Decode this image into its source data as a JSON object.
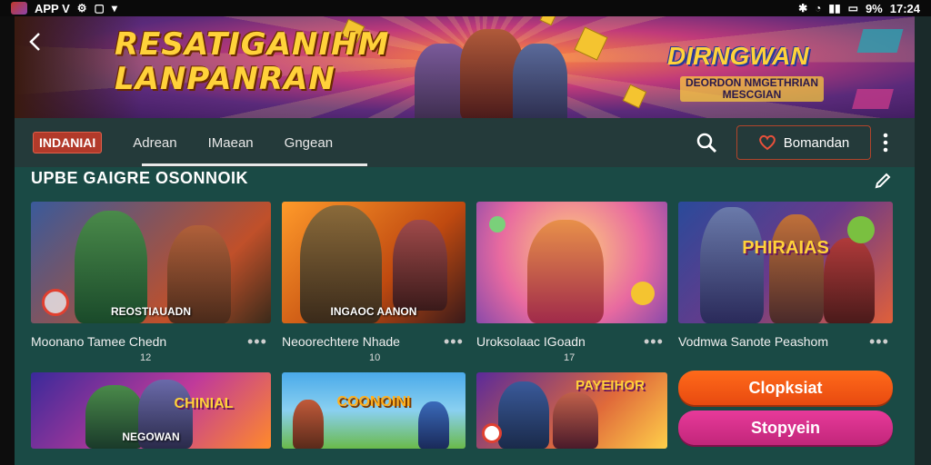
{
  "status_bar": {
    "app_label": "APP V",
    "battery": "9%",
    "time": "17:24"
  },
  "banner": {
    "title_line1": "RESATIGANIHM",
    "title_line2": "LANPANRAN",
    "badge_title": "DIRNGWAN",
    "badge_sub_line1": "DEORDON NMGETHRIAN",
    "badge_sub_line2": "MESCGIAN"
  },
  "nav": {
    "tabs": [
      "INDANIAI",
      "Adrean",
      "IMaean",
      "Gngean"
    ],
    "action_label": "Bomandan"
  },
  "section": {
    "title": "UPBE GAIGRE OSONNOIK"
  },
  "row1": [
    {
      "thumb_label": "REOSTIAUADN",
      "title": "Moonano Tamee Chedn",
      "count": "12"
    },
    {
      "thumb_label": "INGAOC AANON",
      "title": "Neoorechtere Nhade",
      "count": "10"
    },
    {
      "thumb_label": "",
      "title": "Uroksolaac IGoadn",
      "count": "17"
    },
    {
      "thumb_title": "PHIRAIAS",
      "title": "Vodmwa Sanote Peashom",
      "count": ""
    }
  ],
  "row2": [
    {
      "thumb_title": "CHINIAL",
      "thumb_label": "NEGOWAN"
    },
    {
      "thumb_title": "COONOINI"
    },
    {
      "thumb_title": "PAYEIHOR"
    }
  ],
  "buttons": {
    "primary": "Clopksiat",
    "secondary": "Stopyein"
  },
  "colors": {
    "accent_orange": "#e84a10",
    "accent_pink": "#c2267a",
    "teal_bg": "#1a4a45",
    "nav_bg": "#243a3a"
  }
}
